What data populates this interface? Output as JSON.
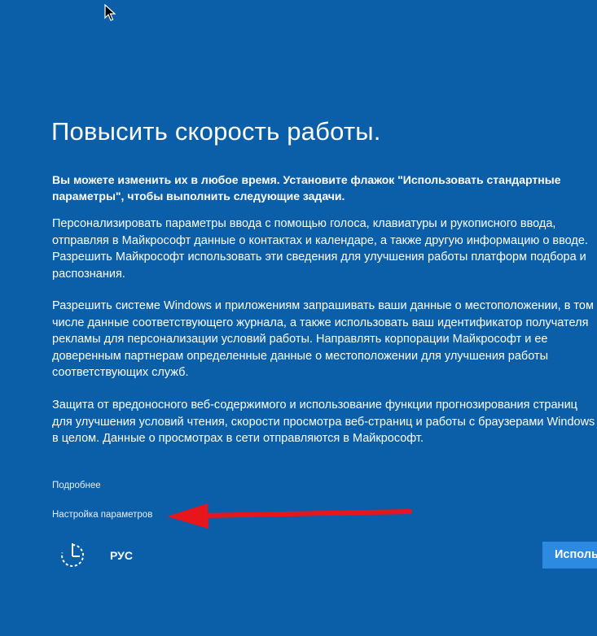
{
  "title": "Повысить скорость работы.",
  "intro": "Вы можете изменить их в любое время. Установите флажок \"Использовать стандартные параметры\", чтобы выполнить следующие задачи.",
  "paragraphs": [
    "Персонализировать параметры ввода с помощью голоса, клавиатуры и рукописного ввода, отправляя в Майкрософт данные о контактах и календаре, а также другую информацию о вводе. Разрешить Майкрософт использовать эти сведения для улучшения работы платформ подбора и распознания.",
    "Разрешить системе Windows и приложениям запрашивать ваши данные о местоположении, в том числе данные соответствующего журнала, а также использовать ваш идентификатор получателя рекламы для персонализации условий работы. Направлять корпорации Майкрософт и ее доверенным партнерам определенные данные о местоположении для улучшения работы соответствующих служб.",
    "Защита от вредоносного веб-содержимого и использование функции прогнозирования страниц для улучшения условий чтения, скорости просмотра веб-страниц и работы с браузерами Windows в целом. Данные о просмотрах в сети отправляются в Майкрософт."
  ],
  "links": {
    "more": "Подробнее",
    "settings": "Настройка параметров"
  },
  "footer": {
    "accessibility_icon": "ease-of-access-icon",
    "language": "РУС",
    "use_button": "Исполь"
  },
  "colors": {
    "background": "#0a5fa8",
    "button": "#2c8ae0",
    "annotation_arrow": "#e8151b"
  }
}
